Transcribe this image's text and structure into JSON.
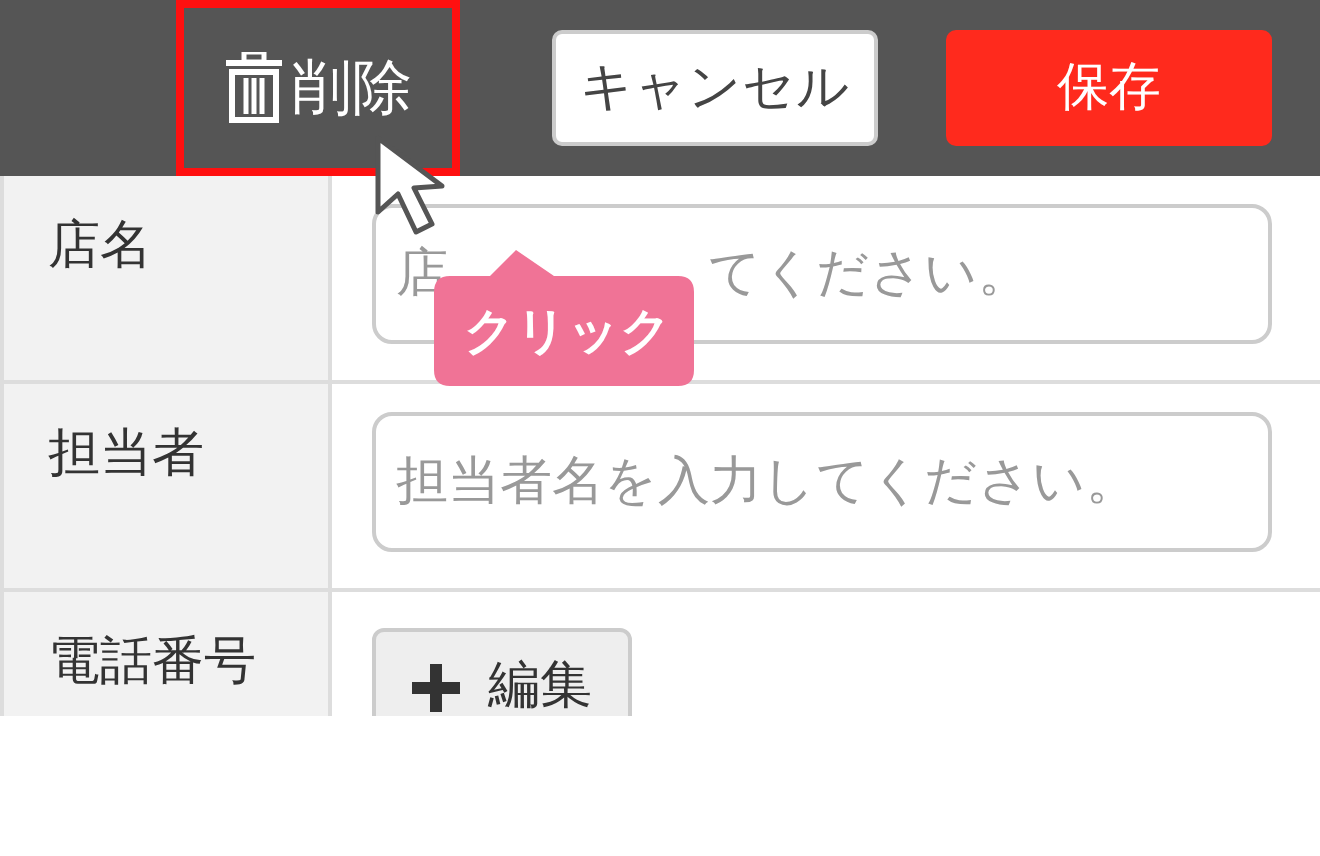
{
  "toolbar": {
    "buttons": [
      {
        "kind": "delete",
        "label": "削除",
        "highlighted": true
      },
      {
        "kind": "cancel",
        "label": "キャンセル",
        "highlighted": false
      },
      {
        "kind": "save",
        "label": "保存",
        "highlighted": false
      }
    ]
  },
  "form": {
    "rows": [
      {
        "kind": "covered_text",
        "label": "店名",
        "placeholder": [
          "店",
          "てください。"
        ]
      },
      {
        "kind": "text",
        "label": "担当者",
        "placeholder": "担当者名を入力してください。"
      },
      {
        "kind": "button",
        "label": "電話番号",
        "button_label": "編集"
      }
    ]
  },
  "annotation": {
    "callout": "クリック"
  }
}
